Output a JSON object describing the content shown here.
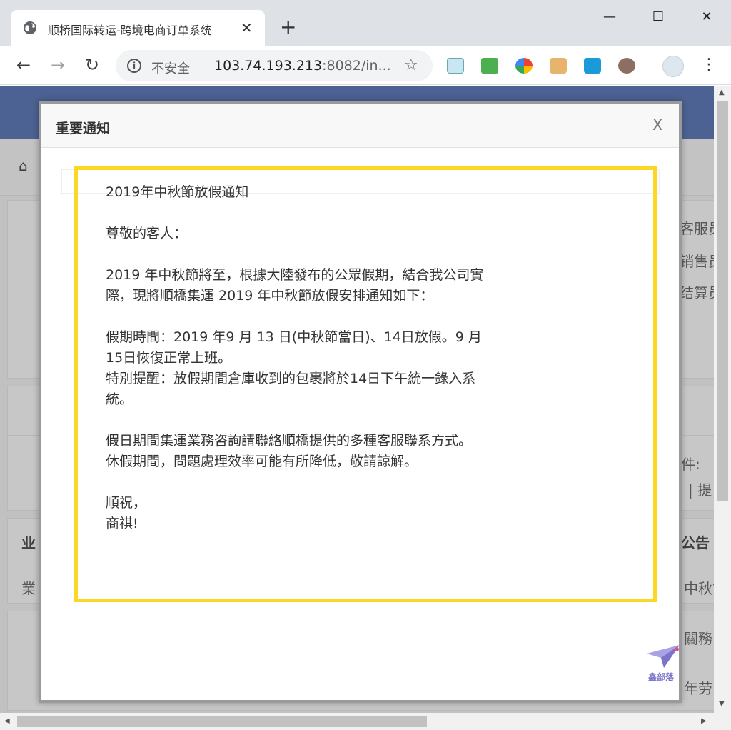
{
  "browser": {
    "tab_title": "顺桥国际转运-跨境电商订单系统",
    "tab_close": "✕",
    "new_tab": "+",
    "security_label": "不安全",
    "url_host": "103.74.193.213",
    "url_rest": ":8082/in...",
    "window_min": "—",
    "window_max": "☐",
    "window_close": "✕"
  },
  "background_page": {
    "right_labels": [
      "客服员",
      "销售员",
      "结算员",
      "件:",
      "|  提",
      "公告",
      "中秋節",
      "關務",
      "年劳"
    ],
    "left_labels": [
      "业",
      "業"
    ]
  },
  "modal": {
    "title": "重要通知",
    "close_label": "X"
  },
  "notice": {
    "heading": "2019年中秋節放假通知",
    "salutation": "尊敬的客人：",
    "para1_line1": "2019 年中秋節將至，根據大陸發布的公眾假期，結合我公司實",
    "para1_line2": "際，現將順橋集運 2019 年中秋節放假安排通知如下：",
    "para2_line1": "假期時間：2019 年9 月 13 日(中秋節當日)、14日放假。9 月",
    "para2_line2": "15日恢復正常上班。",
    "para2_line3": "特別提醒：放假期間倉庫收到的包裹將於14日下午統一錄入系",
    "para2_line4": "統。",
    "para3_line1": "假日期間集運業務咨詢請聯絡順橋提供的多種客服聯系方式。",
    "para3_line2": "休假期間，問題處理效率可能有所降低，敬請諒解。",
    "closing1": "順祝，",
    "closing2": "商祺!"
  },
  "watermark_text": "鑫部落",
  "colors": {
    "highlight_border": "#fcd826",
    "site_header": "#3556a0"
  }
}
